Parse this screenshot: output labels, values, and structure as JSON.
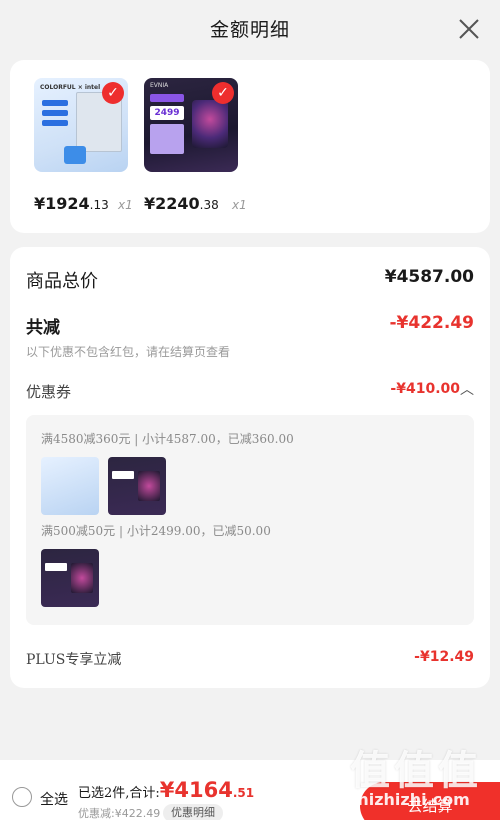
{
  "header": {
    "title": "金额明细",
    "close_icon": "close-icon"
  },
  "products": [
    {
      "name": "motherboard",
      "brand_text": "COLORFUL × intel",
      "price_int": "¥1924",
      "price_dec": ".13",
      "qty": "x1"
    },
    {
      "name": "monitor",
      "brand_text": "EVNIA",
      "tag_price": "2499",
      "price_int": "¥2240",
      "price_dec": ".38",
      "qty": "x1"
    }
  ],
  "summary": {
    "total_label": "商品总价",
    "total_value": "¥4587.00",
    "discount_label": "共减",
    "discount_value": "-¥422.49",
    "discount_note": "以下优惠不包含红包，请在结算页查看",
    "coupon_label": "优惠券",
    "coupon_value": "-¥410.00",
    "coupon_rules": [
      "满4580减360元 | 小计4587.00，已减360.00",
      "满500减50元 | 小计2499.00，已减50.00"
    ],
    "plus_label": "PLUS专享立减",
    "plus_value": "-¥12.49"
  },
  "footer": {
    "select_all": "全选",
    "selected_text": "已选2件,合计:",
    "total_int": "¥4164",
    "total_dec": ".51",
    "saved_text": "优惠减:¥422.49",
    "detail_chip": "优惠明细",
    "checkout": "去结算"
  },
  "watermark": {
    "big": "值值值",
    "small": "zhizhizhi.com"
  },
  "colors": {
    "accent": "#e8332e",
    "background": "#f2f2f2"
  }
}
